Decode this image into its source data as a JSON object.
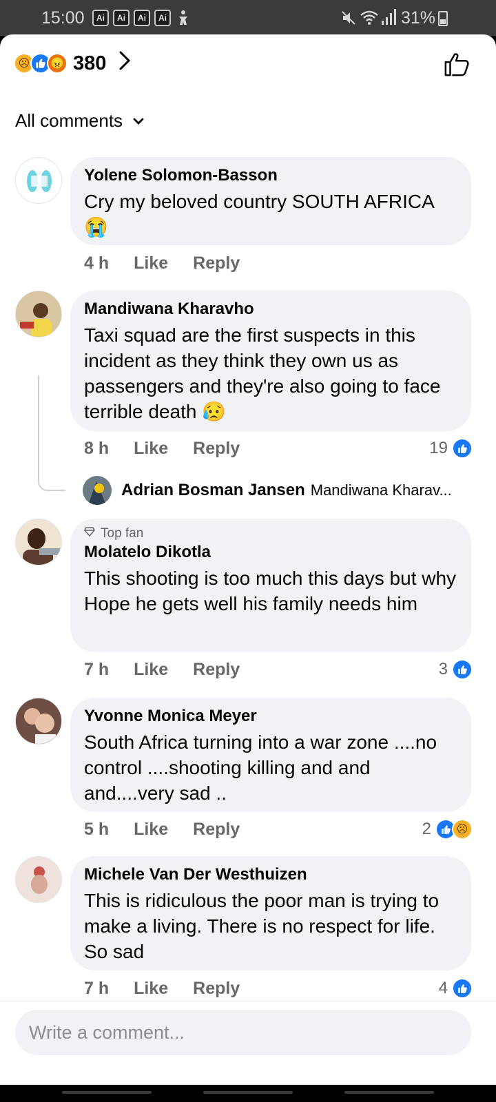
{
  "status_bar": {
    "time": "15:00",
    "ai_badges": [
      "Ai",
      "Ai",
      "Ai",
      "Ai"
    ],
    "battery": "31%"
  },
  "reactions_summary": {
    "icons": [
      "sad-emoji",
      "like",
      "angry-emoji"
    ],
    "count": "380"
  },
  "filter": {
    "label": "All comments"
  },
  "comments": [
    {
      "author": "Yolene Solomon-Basson",
      "text": "Cry my beloved country SOUTH AFRICA",
      "emoji": "😭",
      "time": "4 h",
      "like": "Like",
      "reply": "Reply"
    },
    {
      "author": "Mandiwana Kharavho",
      "text": "Taxi squad are the first suspects in this incident as they think they own us as passengers and they're also going to face terrible death",
      "emoji": "😥",
      "time": "8 h",
      "like": "Like",
      "reply": "Reply",
      "reaction_count": "19",
      "reply_preview": {
        "author": "Adrian Bosman Jansen",
        "snippet": "Mandiwana Kharav..."
      }
    },
    {
      "badge": "Top fan",
      "author": "Molatelo Dikotla",
      "text": "This shooting is too much this days but why Hope he gets well his family needs him",
      "time": "7 h",
      "like": "Like",
      "reply": "Reply",
      "reaction_count": "3"
    },
    {
      "author": "Yvonne Monica Meyer",
      "text": "South Africa turning into a war zone ....no control ....shooting killing and and and....very sad ..",
      "time": "5 h",
      "like": "Like",
      "reply": "Reply",
      "reaction_count": "2"
    },
    {
      "author": "Michele Van Der Westhuizen",
      "text": "This is ridiculous the poor man is trying to make a living. There is no respect for life. So sad",
      "time": "7 h",
      "like": "Like",
      "reply": "Reply",
      "reaction_count": "4"
    }
  ],
  "composer": {
    "placeholder": "Write a comment..."
  },
  "colors": {
    "like_blue": "#1877f2",
    "bubble_gray": "#f0f2f5",
    "meta_gray": "#65676b",
    "status_bar": "#3a3b3c"
  }
}
